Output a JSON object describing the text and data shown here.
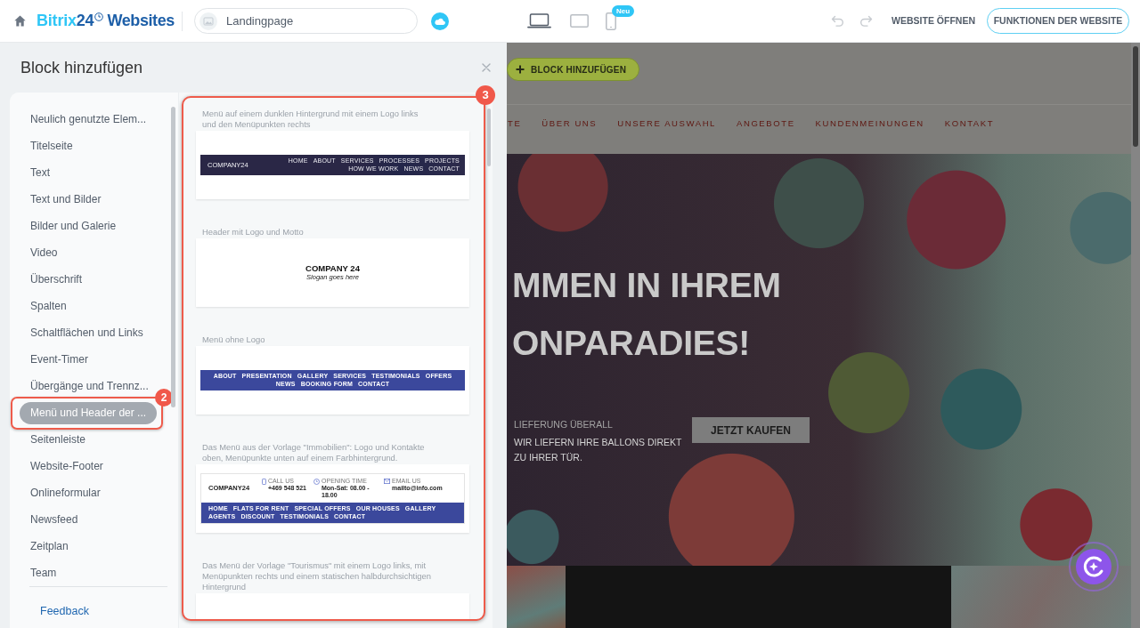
{
  "topbar": {
    "logo": {
      "brand": "Bitrix",
      "number": "24",
      "product": "Websites"
    },
    "page_selector": {
      "value": "Landingpage"
    },
    "devices": [
      {
        "kind": "desktop",
        "selected": true
      },
      {
        "kind": "tablet",
        "selected": false
      },
      {
        "kind": "mobile",
        "selected": false,
        "badge": "Neu"
      }
    ],
    "history": [
      {
        "kind": "undo",
        "disabled": true
      },
      {
        "kind": "redo",
        "disabled": true
      }
    ],
    "open_link": "WEBSITE ÖFFNEN",
    "functions_button": "FUNKTIONEN DER WEBSITE"
  },
  "panel": {
    "title": "Block hinzufügen",
    "categories": [
      {
        "label": "Neulich genutzte Elem...",
        "selected": false
      },
      {
        "label": "Titelseite",
        "selected": false
      },
      {
        "label": "Text",
        "selected": false
      },
      {
        "label": "Text und Bilder",
        "selected": false
      },
      {
        "label": "Bilder und Galerie",
        "selected": false
      },
      {
        "label": "Video",
        "selected": false
      },
      {
        "label": "Überschrift",
        "selected": false
      },
      {
        "label": "Spalten",
        "selected": false
      },
      {
        "label": "Schaltflächen und Links",
        "selected": false
      },
      {
        "label": "Event-Timer",
        "selected": false
      },
      {
        "label": "Übergänge und Trennz...",
        "selected": false
      },
      {
        "label": "Menü und Header der ...",
        "selected": true,
        "callout": "2"
      },
      {
        "label": "Seitenleiste",
        "selected": false
      },
      {
        "label": "Website-Footer",
        "selected": false
      },
      {
        "label": "Onlineformular",
        "selected": false
      },
      {
        "label": "Newsfeed",
        "selected": false
      },
      {
        "label": "Zeitplan",
        "selected": false
      },
      {
        "label": "Team",
        "selected": false
      }
    ],
    "feedback": "Feedback",
    "previews_callout": "3",
    "previews": [
      {
        "description": "Menü auf einem dunklen Hintergrund mit einem Logo links und den Menüpunkten rechts",
        "kind": "dark_menu",
        "logo": "COMPANY24",
        "menu": [
          "HOME",
          "ABOUT",
          "SERVICES",
          "PROCESSES",
          "PROJECTS",
          "HOW WE WORK",
          "NEWS",
          "CONTACT"
        ]
      },
      {
        "description": "Header mit Logo und Motto",
        "kind": "logo_slogan",
        "logo": "COMPANY 24",
        "slogan": "Slogan goes here"
      },
      {
        "description": "Menü ohne Logo",
        "kind": "menu_bar",
        "menu": [
          "ABOUT",
          "PRESENTATION",
          "GALLERY",
          "SERVICES",
          "TESTIMONIALS",
          "OFFERS",
          "NEWS",
          "BOOKING FORM",
          "CONTACT"
        ]
      },
      {
        "description": "Das Menü aus der Vorlage \"Immobilien\": Logo und Kontakte oben, Menüpunkte unten auf einem Farbhintergrund.",
        "kind": "contacts_menu",
        "logo": "COMPANY24",
        "contacts": [
          {
            "kind": "phone",
            "label": "CALL US",
            "value": "+469 548 521"
          },
          {
            "kind": "clock",
            "label": "OPENING TIME",
            "value": "Mon-Sat: 08.00 - 18.00"
          },
          {
            "kind": "mail",
            "label": "EMAIL US",
            "value": "mailto@info.com"
          }
        ],
        "menu": [
          "HOME",
          "FLATS FOR RENT",
          "SPECIAL OFFERS",
          "OUR HOUSES",
          "GALLERY",
          "AGENTS",
          "DISCOUNT",
          "TESTIMONIALS",
          "CONTACT"
        ]
      },
      {
        "description": "Das Menü der Vorlage \"Tourismus\" mit einem Logo links, mit Menüpunkten rechts und einem statischen halbdurchsichtigen Hintergrund",
        "kind": "blank"
      }
    ]
  },
  "site": {
    "add_block_button": "BLOCK HINZUFÜGEN",
    "nav": [
      "TE",
      "ÜBER UNS",
      "UNSERE AUSWAHL",
      "ANGEBOTE",
      "KUNDENMEINUNGEN",
      "KONTAKT"
    ],
    "hero": {
      "headline": [
        "MMEN IN IHREM",
        "ONPARADIES!"
      ],
      "eyebrow": "LIEFERUNG ÜBERALL",
      "text": "WIR LIEFERN IHRE BALLONS DIREKT ZU IHRER TÜR.",
      "button": "JETZT KAUFEN"
    }
  }
}
